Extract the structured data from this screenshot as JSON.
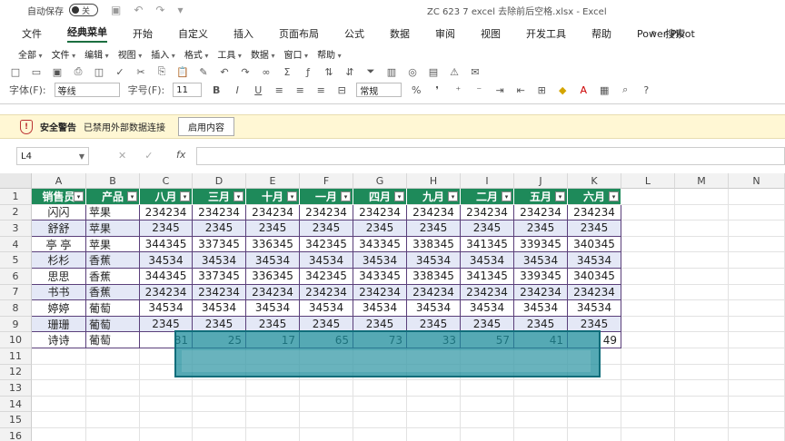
{
  "titlebar": {
    "autosave": "自动保存",
    "toggle": "关",
    "title": "ZC 623 7 excel 去除前后空格.xlsx  -  Excel"
  },
  "menubar": {
    "items": [
      "文件",
      "经典菜单",
      "开始",
      "自定义",
      "插入",
      "页面布局",
      "公式",
      "数据",
      "审阅",
      "视图",
      "开发工具",
      "帮助",
      "Power Pivot"
    ],
    "active": "经典菜单",
    "search": "搜索"
  },
  "classic_menu": [
    "全部",
    "文件",
    "编辑",
    "视图",
    "插入",
    "格式",
    "工具",
    "数据",
    "窗口",
    "帮助"
  ],
  "toolbar": {
    "font_label": "字体(F):",
    "font_value": "等线",
    "size_label": "字号(F):",
    "size_value": "11",
    "bold": "B",
    "italic": "I",
    "underline": "U",
    "number_format": "常规",
    "percent": "%"
  },
  "warning": {
    "title": "安全警告",
    "message": "已禁用外部数据连接",
    "button": "启用内容"
  },
  "formula": {
    "namebox": "L4",
    "fx": "fx",
    "value": ""
  },
  "columns": [
    "A",
    "B",
    "C",
    "D",
    "E",
    "F",
    "G",
    "H",
    "I",
    "J",
    "K",
    "L",
    "M",
    "N"
  ],
  "rows": [
    "1",
    "2",
    "3",
    "4",
    "5",
    "6",
    "7",
    "8",
    "9",
    "10",
    "11",
    "12",
    "13",
    "14",
    "15",
    "16"
  ],
  "table": {
    "headers": [
      "销售员",
      "产品",
      "八月",
      "三月",
      "十月",
      "一月",
      "四月",
      "九月",
      "二月",
      "五月",
      "六月"
    ],
    "data": [
      [
        "闪闪",
        "苹果",
        "234234",
        "234234",
        "234234",
        "234234",
        "234234",
        "234234",
        "234234",
        "234234",
        "234234"
      ],
      [
        "舒舒",
        "苹果",
        "2345",
        "2345",
        "2345",
        "2345",
        "2345",
        "2345",
        "2345",
        "2345",
        "2345"
      ],
      [
        "亭 亭",
        "苹果",
        "344345",
        "337345",
        "336345",
        "342345",
        "343345",
        "338345",
        "341345",
        "339345",
        "340345"
      ],
      [
        "杉杉",
        "香蕉",
        "34534",
        "34534",
        "34534",
        "34534",
        "34534",
        "34534",
        "34534",
        "34534",
        "34534"
      ],
      [
        "思思",
        "香蕉",
        "344345",
        "337345",
        "336345",
        "342345",
        "343345",
        "338345",
        "341345",
        "339345",
        "340345"
      ],
      [
        "书书",
        "香蕉",
        "234234",
        "234234",
        "234234",
        "234234",
        "234234",
        "234234",
        "234234",
        "234234",
        "234234"
      ],
      [
        "婷婷",
        "葡萄",
        "34534",
        "34534",
        "34534",
        "34534",
        "34534",
        "34534",
        "34534",
        "34534",
        "34534"
      ],
      [
        "珊珊",
        "葡萄",
        "2345",
        "2345",
        "2345",
        "2345",
        "2345",
        "2345",
        "2345",
        "2345",
        "2345"
      ],
      [
        "诗诗",
        "葡萄",
        "81",
        "25",
        "17",
        "65",
        "73",
        "33",
        "57",
        "41",
        "49"
      ]
    ]
  },
  "colors": {
    "header_green": "#1e8a5a",
    "band": "#e4e8f6",
    "selection": "#1c8c9b"
  }
}
